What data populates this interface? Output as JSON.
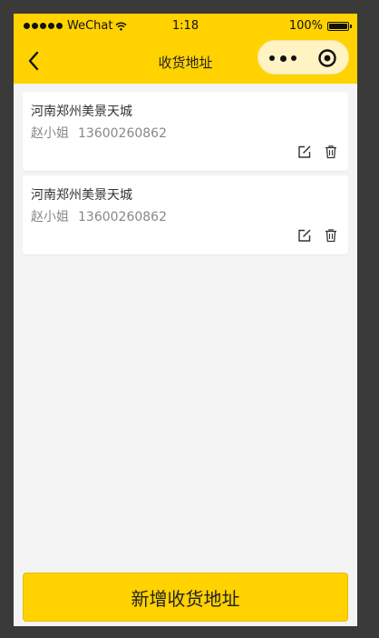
{
  "status": {
    "carrier": "WeChat",
    "time": "1:18",
    "battery": "100%"
  },
  "nav": {
    "title": "收货地址"
  },
  "addresses": [
    {
      "address": "河南郑州美景天城",
      "name": "赵小姐",
      "phone": "13600260862"
    },
    {
      "address": "河南郑州美景天城",
      "name": "赵小姐",
      "phone": "13600260862"
    }
  ],
  "actions": {
    "add_label": "新增收货地址"
  },
  "icons": {
    "back": "chevron-left-icon",
    "more": "more-dots-icon",
    "close": "target-close-icon",
    "edit": "edit-icon",
    "trash": "trash-icon"
  },
  "colors": {
    "header": "#ffd200",
    "capsule": "#fff3c4",
    "page_bg": "#f4f4f4",
    "button": "#ffd200"
  }
}
